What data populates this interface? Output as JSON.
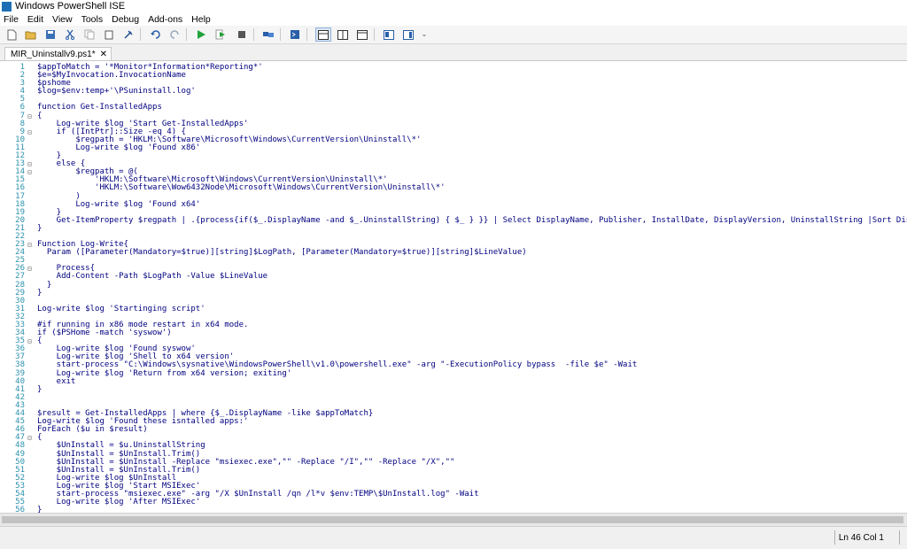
{
  "window": {
    "title": "Windows PowerShell ISE",
    "icon": "powershell-icon"
  },
  "menu": [
    "File",
    "Edit",
    "View",
    "Tools",
    "Debug",
    "Add-ons",
    "Help"
  ],
  "toolbar": {
    "icons": [
      "new-icon",
      "open-icon",
      "save-icon",
      "cut-icon",
      "copy-icon",
      "paste-icon",
      "clear-icon",
      "undo-icon",
      "redo-icon",
      "run-icon",
      "run-selection-icon",
      "stop-icon",
      "remote-icon",
      "powershell-tab-icon",
      "layout-top-icon",
      "layout-right-icon",
      "layout-max-icon",
      "show-script-icon",
      "show-commands-icon",
      "more-icon"
    ]
  },
  "tab": {
    "name": "MIR_Uninstallv9.ps1*",
    "close": "✕"
  },
  "code_lines": [
    {
      "n": "1",
      "fold": "",
      "text": "$appToMatch = '*Monitor*Information*Reporting*'"
    },
    {
      "n": "2",
      "fold": "",
      "text": "$e=$MyInvocation.InvocationName"
    },
    {
      "n": "3",
      "fold": "",
      "text": "$pshome"
    },
    {
      "n": "4",
      "fold": "",
      "text": "$log=$env:temp+'\\PSuninstall.log'"
    },
    {
      "n": "5",
      "fold": "",
      "text": ""
    },
    {
      "n": "6",
      "fold": "",
      "text": "function Get-InstalledApps"
    },
    {
      "n": "7",
      "fold": "⊟",
      "text": "{"
    },
    {
      "n": "8",
      "fold": "",
      "text": "    Log-write $log 'Start Get-InstalledApps'"
    },
    {
      "n": "9",
      "fold": "⊟",
      "text": "    if ([IntPtr]::Size -eq 4) {"
    },
    {
      "n": "10",
      "fold": "",
      "text": "        $regpath = 'HKLM:\\Software\\Microsoft\\Windows\\CurrentVersion\\Uninstall\\*'"
    },
    {
      "n": "11",
      "fold": "",
      "text": "        Log-write $log 'Found x86'"
    },
    {
      "n": "12",
      "fold": "",
      "text": "    }"
    },
    {
      "n": "13",
      "fold": "⊟",
      "text": "    else {"
    },
    {
      "n": "14",
      "fold": "⊟",
      "text": "        $regpath = @("
    },
    {
      "n": "15",
      "fold": "",
      "text": "            'HKLM:\\Software\\Microsoft\\Windows\\CurrentVersion\\Uninstall\\*'"
    },
    {
      "n": "16",
      "fold": "",
      "text": "            'HKLM:\\Software\\Wow6432Node\\Microsoft\\Windows\\CurrentVersion\\Uninstall\\*'"
    },
    {
      "n": "17",
      "fold": "",
      "text": "        )"
    },
    {
      "n": "18",
      "fold": "",
      "text": "        Log-write $log 'Found x64'"
    },
    {
      "n": "19",
      "fold": "",
      "text": "    }"
    },
    {
      "n": "20",
      "fold": "",
      "text": "    Get-ItemProperty $regpath | .{process{if($_.DisplayName -and $_.UninstallString) { $_ } }} | Select DisplayName, Publisher, InstallDate, DisplayVersion, UninstallString |Sort DisplayName"
    },
    {
      "n": "21",
      "fold": "",
      "text": "}"
    },
    {
      "n": "22",
      "fold": "",
      "text": ""
    },
    {
      "n": "23",
      "fold": "⊟",
      "text": "Function Log-Write{"
    },
    {
      "n": "24",
      "fold": "",
      "text": "  Param ([Parameter(Mandatory=$true)][string]$LogPath, [Parameter(Mandatory=$true)][string]$LineValue)"
    },
    {
      "n": "25",
      "fold": "",
      "text": ""
    },
    {
      "n": "26",
      "fold": "⊟",
      "text": "    Process{"
    },
    {
      "n": "27",
      "fold": "",
      "text": "    Add-Content -Path $LogPath -Value $LineValue"
    },
    {
      "n": "28",
      "fold": "",
      "text": "  }"
    },
    {
      "n": "29",
      "fold": "",
      "text": "}"
    },
    {
      "n": "30",
      "fold": "",
      "text": ""
    },
    {
      "n": "31",
      "fold": "",
      "text": "Log-write $log 'Startinging script'"
    },
    {
      "n": "32",
      "fold": "",
      "text": ""
    },
    {
      "n": "33",
      "fold": "",
      "text": "#if running in x86 mode restart in x64 mode."
    },
    {
      "n": "34",
      "fold": "",
      "text": "if ($PSHome -match 'syswow')"
    },
    {
      "n": "35",
      "fold": "⊟",
      "text": "{"
    },
    {
      "n": "36",
      "fold": "",
      "text": "    Log-write $log 'Found syswow'"
    },
    {
      "n": "37",
      "fold": "",
      "text": "    Log-write $log 'Shell to x64 version'"
    },
    {
      "n": "38",
      "fold": "",
      "text": "    start-process \"C:\\Windows\\sysnative\\WindowsPowerShell\\v1.0\\powershell.exe\" -arg \"-ExecutionPolicy bypass  -file $e\" -Wait"
    },
    {
      "n": "39",
      "fold": "",
      "text": "    Log-write $log 'Return from x64 version; exiting'"
    },
    {
      "n": "40",
      "fold": "",
      "text": "    exit"
    },
    {
      "n": "41",
      "fold": "",
      "text": "}"
    },
    {
      "n": "42",
      "fold": "",
      "text": ""
    },
    {
      "n": "43",
      "fold": "",
      "text": ""
    },
    {
      "n": "44",
      "fold": "",
      "text": "$result = Get-InstalledApps | where {$_.DisplayName -like $appToMatch}"
    },
    {
      "n": "45",
      "fold": "",
      "text": "Log-write $log 'Found these isntalled apps:'"
    },
    {
      "n": "46",
      "fold": "",
      "text": "ForEach ($u in $result)"
    },
    {
      "n": "47",
      "fold": "⊟",
      "text": "{"
    },
    {
      "n": "48",
      "fold": "",
      "text": "    $UnInstall = $u.UninstallString"
    },
    {
      "n": "49",
      "fold": "",
      "text": "    $UnInstall = $UnInstall.Trim()"
    },
    {
      "n": "50",
      "fold": "",
      "text": "    $UnInstall = $UnInstall -Replace \"msiexec.exe\",\"\" -Replace \"/I\",\"\" -Replace \"/X\",\"\""
    },
    {
      "n": "51",
      "fold": "",
      "text": "    $UnInstall = $UnInstall.Trim()"
    },
    {
      "n": "52",
      "fold": "",
      "text": "    Log-write $log $UnInstall"
    },
    {
      "n": "53",
      "fold": "",
      "text": "    Log-write $log 'Start MSIExec'"
    },
    {
      "n": "54",
      "fold": "",
      "text": "    start-process \"msiexec.exe\" -arg \"/X $UnInstall /qn /l*v $env:TEMP\\$UnInstall.log\" -Wait"
    },
    {
      "n": "55",
      "fold": "",
      "text": "    Log-write $log 'After MSIExec'"
    },
    {
      "n": "56",
      "fold": "",
      "text": "}"
    }
  ],
  "status": {
    "position": "Ln 46  Col 1"
  }
}
